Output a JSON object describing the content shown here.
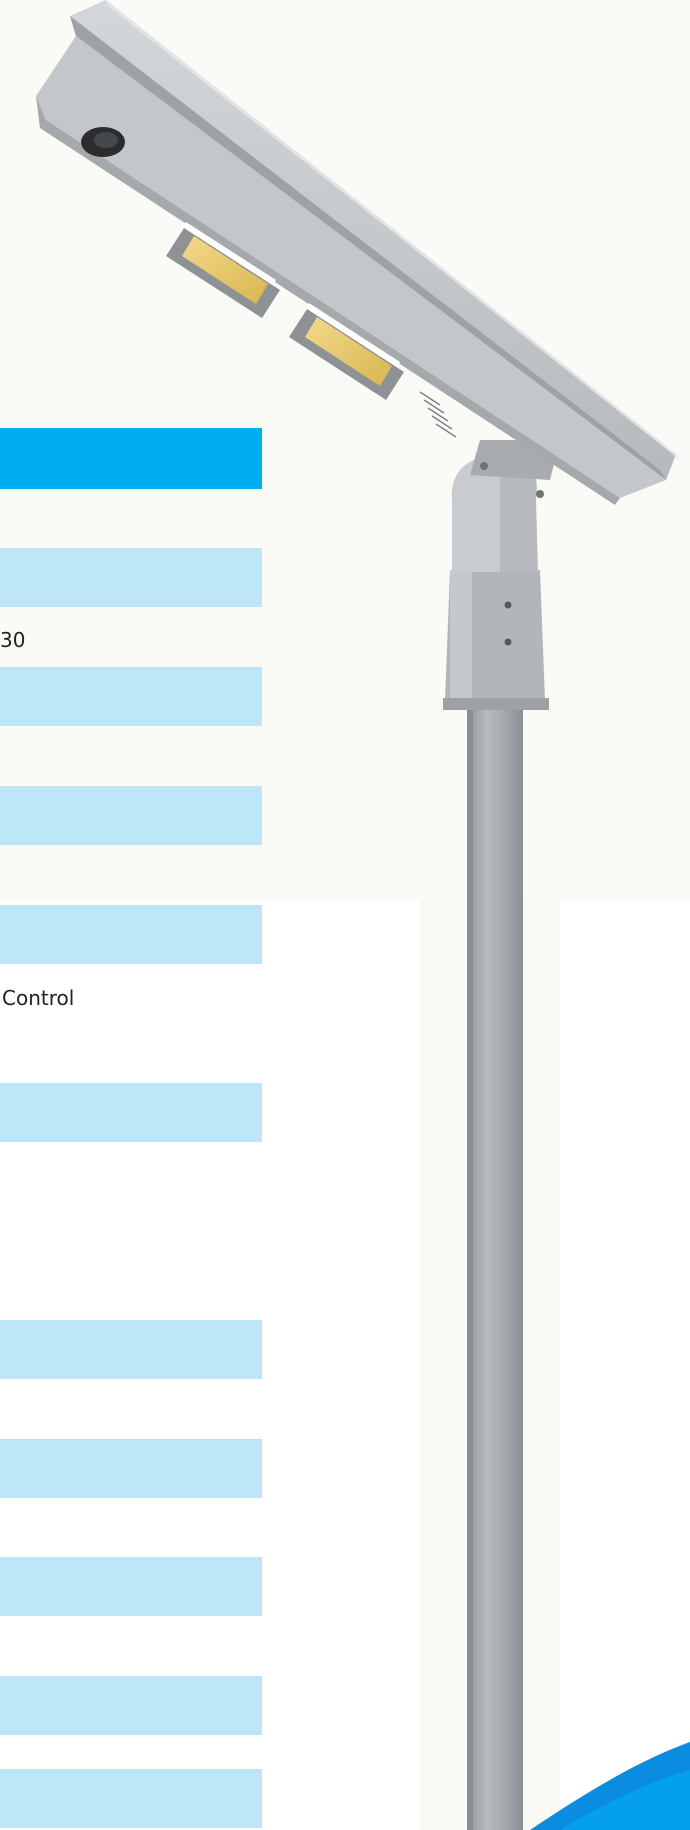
{
  "spec_table": {
    "visible_text": {
      "partial_value_1": "30",
      "partial_value_2": "Control"
    }
  },
  "product_image": {
    "subject": "solar-street-light-icon"
  },
  "colors": {
    "header_blue": "#00aeef",
    "row_blue": "#bee6f9",
    "pole_gray": "#a9adb1",
    "panel_gray": "#c8cbce",
    "accent_swoosh": "#0a8de0"
  }
}
